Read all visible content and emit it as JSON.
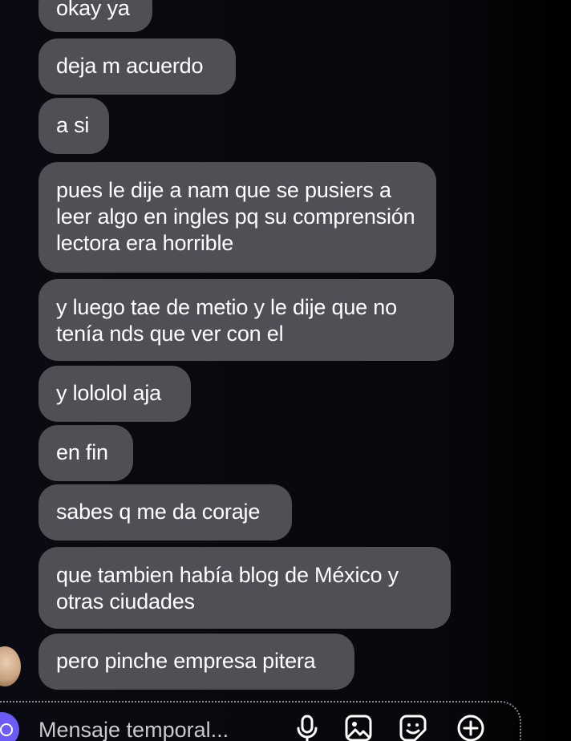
{
  "conversation": {
    "messages": [
      {
        "text": "okay ya"
      },
      {
        "text": "deja m acuerdo"
      },
      {
        "text": "a si"
      },
      {
        "text": "pues le dije a nam que se pusiers a leer algo en ingles pq su comprensión lectora era horrible"
      },
      {
        "text": "y luego tae de metio y le dije que no tenía nds que ver con el"
      },
      {
        "text": "y lololol aja"
      },
      {
        "text": "en fin"
      },
      {
        "text": "sabes q me da coraje"
      },
      {
        "text": "que tambien había blog de México y otras ciudades"
      },
      {
        "text": "pero pinche empresa pitera"
      }
    ]
  },
  "composer": {
    "placeholder": "Mensaje temporal...",
    "icons": [
      "camera-icon",
      "microphone-icon",
      "gallery-icon",
      "sticker-icon",
      "add-icon"
    ]
  },
  "colors": {
    "background": "#07070b",
    "bubble": "#4f4f55",
    "text": "#ffffff",
    "camera_accent": "#6d5bf6"
  }
}
